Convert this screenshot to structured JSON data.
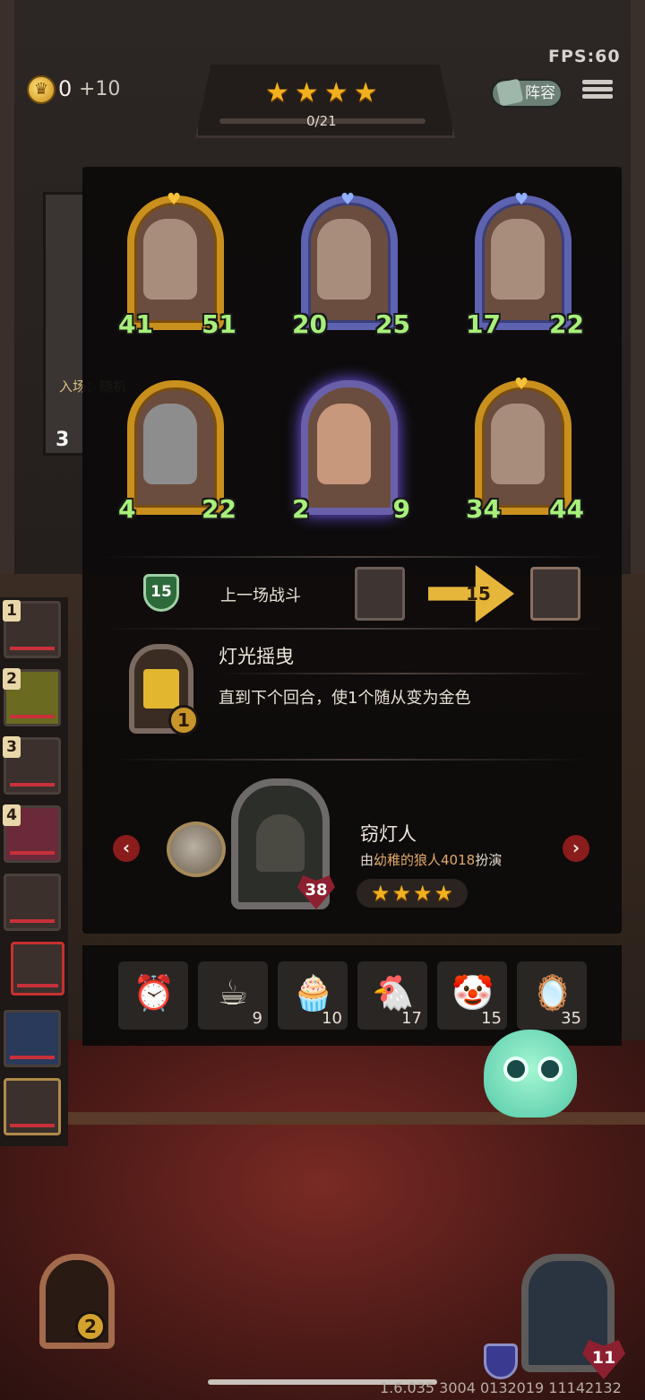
{
  "hud": {
    "fps": "FPS:60",
    "gold": "0",
    "gold_income": "+10",
    "stars": [
      "★",
      "★",
      "★",
      "★"
    ],
    "progress": "0/21",
    "lineup_label": "阵容"
  },
  "background": {
    "enter_text": "入场：随机",
    "card_count": "3"
  },
  "minions": [
    {
      "attack": "41",
      "health": "51",
      "frame": "gold"
    },
    {
      "attack": "20",
      "health": "25",
      "frame": "blue"
    },
    {
      "attack": "17",
      "health": "22",
      "frame": "blue"
    },
    {
      "attack": "4",
      "health": "22",
      "frame": "gold"
    },
    {
      "attack": "2",
      "health": "9",
      "frame": "blue"
    },
    {
      "attack": "34",
      "health": "44",
      "frame": "gold"
    }
  ],
  "battle": {
    "shield_value": "15",
    "label": "上一场战斗",
    "damage": "15"
  },
  "spell": {
    "name": "灯光摇曳",
    "description": "直到下个回合，使1个随从变为金色",
    "cost": "1"
  },
  "hero": {
    "name": "窃灯人",
    "by_prefix": "由",
    "by_player": "幼稚的狼人4018",
    "by_suffix": "扮演",
    "health": "38",
    "stars": [
      "★",
      "★",
      "★",
      "★"
    ]
  },
  "items": [
    {
      "icon": "alarm-clock-icon",
      "glyph": "⏰",
      "count": ""
    },
    {
      "icon": "teacup-icon",
      "glyph": "☕",
      "count": "9"
    },
    {
      "icon": "cupcake-icon",
      "glyph": "🧁",
      "count": "10"
    },
    {
      "icon": "rubber-chicken-icon",
      "glyph": "🐔",
      "count": "17"
    },
    {
      "icon": "clown-icon",
      "glyph": "🤡",
      "count": "15"
    },
    {
      "icon": "mirror-icon",
      "glyph": "🪞",
      "count": "35"
    }
  ],
  "rail": [
    {
      "num": "1"
    },
    {
      "num": "2"
    },
    {
      "num": "3"
    },
    {
      "num": "4"
    },
    {
      "num": ""
    },
    {
      "num": ""
    },
    {
      "num": ""
    },
    {
      "num": ""
    }
  ],
  "bottom": {
    "hand_count": "2",
    "player_health": "11",
    "version": "1.6.035 3004 0132019 11142132"
  },
  "colors": {
    "gold_frame": "#c9901e",
    "blue_frame": "#5d63b0",
    "star": "#f2b01e",
    "health_heart": "#8d2030",
    "nav_red": "#8a1c1c"
  }
}
